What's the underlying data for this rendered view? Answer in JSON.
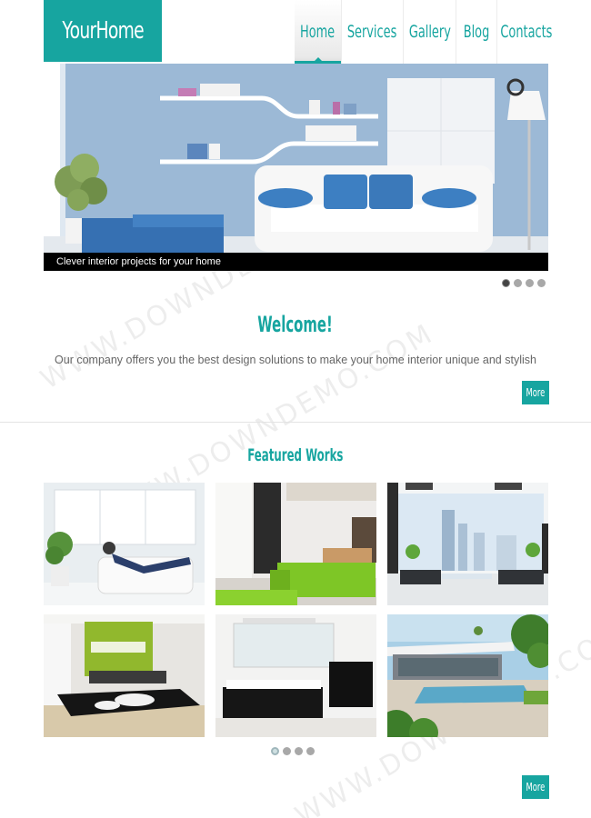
{
  "header": {
    "logo_text": "YourHome",
    "nav": [
      {
        "label": "Home",
        "active": true
      },
      {
        "label": "Services",
        "active": false
      },
      {
        "label": "Gallery",
        "active": false
      },
      {
        "label": "Blog",
        "active": false
      },
      {
        "label": "Contacts",
        "active": false
      }
    ]
  },
  "slider": {
    "caption": "Clever interior projects for your home",
    "slide_count": 4,
    "active_slide": 1
  },
  "welcome": {
    "title": "Welcome!",
    "text": "Our company offers you the best design solutions to make your home interior unique and stylish",
    "more_label": "More"
  },
  "featured": {
    "title": "Featured Works",
    "page_count": 4,
    "active_page": 1,
    "more_label": "More"
  },
  "watermark": "WWW.DOWNDEMO.COM",
  "colors": {
    "accent": "#17a5a0",
    "caption_bar": "#000000"
  }
}
